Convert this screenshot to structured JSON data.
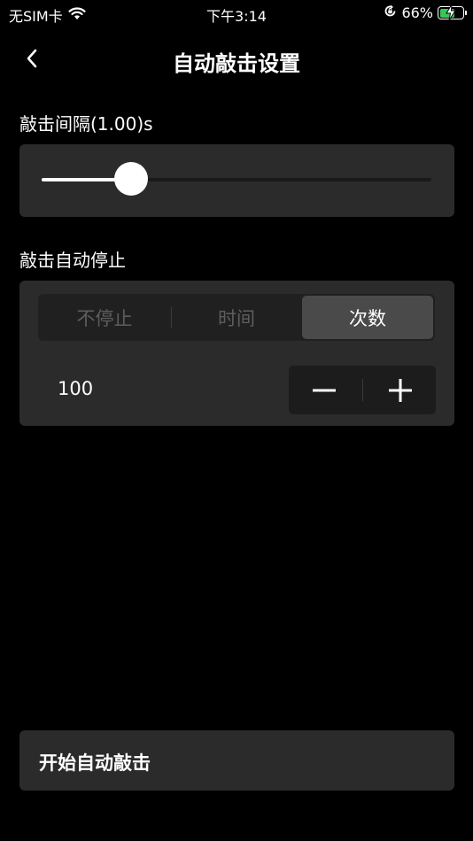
{
  "status_bar": {
    "carrier": "无SIM卡",
    "time": "下午3:14",
    "battery_percent": "66%",
    "battery_level": 0.66
  },
  "nav": {
    "title": "自动敲击设置"
  },
  "interval": {
    "label": "敲击间隔(1.00)s",
    "slider_value": 0.23
  },
  "auto_stop": {
    "label": "敲击自动停止",
    "options": [
      "不停止",
      "时间",
      "次数"
    ],
    "selected_index": 2
  },
  "counter": {
    "value": "100"
  },
  "start_button": {
    "label": "开始自动敲击"
  },
  "colors": {
    "background": "#000000",
    "card": "#2b2b2b",
    "active_segment": "#4a4a4a",
    "battery_fill": "#34c759"
  }
}
